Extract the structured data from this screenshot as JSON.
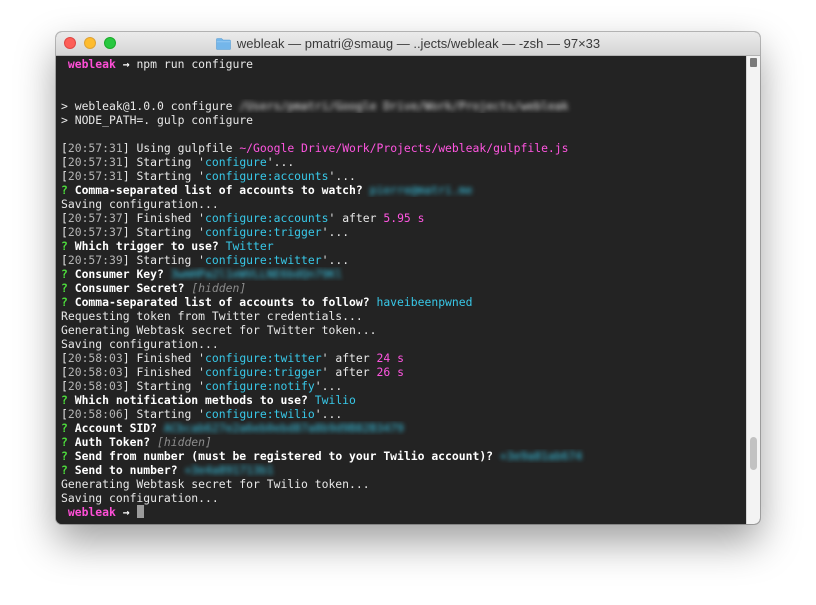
{
  "window": {
    "title": "webleak — pmatri@smaug — ..jects/webleak — -zsh — 97×33"
  },
  "terminal": {
    "lines": [
      [
        {
          "t": "webleak",
          "c": "prompt",
          "pre": " "
        },
        {
          "t": " → ",
          "c": "arrow"
        },
        {
          "t": "npm run configure",
          "c": "default"
        }
      ],
      [],
      [],
      [
        {
          "t": "> webleak@1.0.0 configure ",
          "c": "default"
        },
        {
          "t": "/Users/pmatri/Google Drive/Work/Projects/webleak",
          "c": "default",
          "blur": true
        }
      ],
      [
        {
          "t": "> NODE_PATH=. gulp configure",
          "c": "default"
        }
      ],
      [],
      [
        {
          "t": "[",
          "c": "default"
        },
        {
          "t": "20:57:31",
          "c": "ts"
        },
        {
          "t": "] Using gulpfile ",
          "c": "default"
        },
        {
          "t": "~/Google Drive/Work/Projects/webleak/gulpfile.js",
          "c": "magenta"
        }
      ],
      [
        {
          "t": "[",
          "c": "default"
        },
        {
          "t": "20:57:31",
          "c": "ts"
        },
        {
          "t": "] Starting '",
          "c": "default"
        },
        {
          "t": "configure",
          "c": "task"
        },
        {
          "t": "'...",
          "c": "default"
        }
      ],
      [
        {
          "t": "[",
          "c": "default"
        },
        {
          "t": "20:57:31",
          "c": "ts"
        },
        {
          "t": "] Starting '",
          "c": "default"
        },
        {
          "t": "configure:accounts",
          "c": "task"
        },
        {
          "t": "'...",
          "c": "default"
        }
      ],
      [
        {
          "t": "? ",
          "c": "green"
        },
        {
          "t": "Comma-separated list of accounts to watch? ",
          "c": "bold"
        },
        {
          "t": "pierre@matri.me",
          "c": "answer",
          "blur": true
        }
      ],
      [
        {
          "t": "Saving configuration...",
          "c": "default"
        }
      ],
      [
        {
          "t": "[",
          "c": "default"
        },
        {
          "t": "20:57:37",
          "c": "ts"
        },
        {
          "t": "] Finished '",
          "c": "default"
        },
        {
          "t": "configure:accounts",
          "c": "task"
        },
        {
          "t": "' after ",
          "c": "default"
        },
        {
          "t": "5.95 s",
          "c": "magenta"
        }
      ],
      [
        {
          "t": "[",
          "c": "default"
        },
        {
          "t": "20:57:37",
          "c": "ts"
        },
        {
          "t": "] Starting '",
          "c": "default"
        },
        {
          "t": "configure:trigger",
          "c": "task"
        },
        {
          "t": "'...",
          "c": "default"
        }
      ],
      [
        {
          "t": "? ",
          "c": "green"
        },
        {
          "t": "Which trigger to use? ",
          "c": "bold"
        },
        {
          "t": "Twitter",
          "c": "answer"
        }
      ],
      [
        {
          "t": "[",
          "c": "default"
        },
        {
          "t": "20:57:39",
          "c": "ts"
        },
        {
          "t": "] Starting '",
          "c": "default"
        },
        {
          "t": "configure:twitter",
          "c": "task"
        },
        {
          "t": "'...",
          "c": "default"
        }
      ],
      [
        {
          "t": "? ",
          "c": "green"
        },
        {
          "t": "Consumer Key? ",
          "c": "bold"
        },
        {
          "t": "3wmHPa2l1eWVLLNE6bdQn79Kl",
          "c": "answer",
          "blur": true
        }
      ],
      [
        {
          "t": "? ",
          "c": "green"
        },
        {
          "t": "Consumer Secret? ",
          "c": "bold"
        },
        {
          "t": "[hidden]",
          "c": "hidden"
        }
      ],
      [
        {
          "t": "? ",
          "c": "green"
        },
        {
          "t": "Comma-separated list of accounts to follow? ",
          "c": "bold"
        },
        {
          "t": "haveibeenpwned",
          "c": "answer"
        }
      ],
      [
        {
          "t": "Requesting token from Twitter credentials...",
          "c": "default"
        }
      ],
      [
        {
          "t": "Generating Webtask secret for Twitter token...",
          "c": "default"
        }
      ],
      [
        {
          "t": "Saving configuration...",
          "c": "default"
        }
      ],
      [
        {
          "t": "[",
          "c": "default"
        },
        {
          "t": "20:58:03",
          "c": "ts"
        },
        {
          "t": "] Finished '",
          "c": "default"
        },
        {
          "t": "configure:twitter",
          "c": "task"
        },
        {
          "t": "' after ",
          "c": "default"
        },
        {
          "t": "24 s",
          "c": "magenta"
        }
      ],
      [
        {
          "t": "[",
          "c": "default"
        },
        {
          "t": "20:58:03",
          "c": "ts"
        },
        {
          "t": "] Finished '",
          "c": "default"
        },
        {
          "t": "configure:trigger",
          "c": "task"
        },
        {
          "t": "' after ",
          "c": "default"
        },
        {
          "t": "26 s",
          "c": "magenta"
        }
      ],
      [
        {
          "t": "[",
          "c": "default"
        },
        {
          "t": "20:58:03",
          "c": "ts"
        },
        {
          "t": "] Starting '",
          "c": "default"
        },
        {
          "t": "configure:notify",
          "c": "task"
        },
        {
          "t": "'...",
          "c": "default"
        }
      ],
      [
        {
          "t": "? ",
          "c": "green"
        },
        {
          "t": "Which notification methods to use? ",
          "c": "bold"
        },
        {
          "t": "Twilio",
          "c": "answer"
        }
      ],
      [
        {
          "t": "[",
          "c": "default"
        },
        {
          "t": "20:58:06",
          "c": "ts"
        },
        {
          "t": "] Starting '",
          "c": "default"
        },
        {
          "t": "configure:twilio",
          "c": "task"
        },
        {
          "t": "'...",
          "c": "default"
        }
      ],
      [
        {
          "t": "? ",
          "c": "green"
        },
        {
          "t": "Account SID? ",
          "c": "bold"
        },
        {
          "t": "ACbcab627e2a6eb0ebd87a8b9d9B82B3479",
          "c": "answer",
          "blur": true
        }
      ],
      [
        {
          "t": "? ",
          "c": "green"
        },
        {
          "t": "Auth Token? ",
          "c": "bold"
        },
        {
          "t": "[hidden]",
          "c": "hidden"
        }
      ],
      [
        {
          "t": "? ",
          "c": "green"
        },
        {
          "t": "Send from number (must be registered to your Twilio account)? ",
          "c": "bold"
        },
        {
          "t": "+3e9a81ab674",
          "c": "answer",
          "blur": true
        }
      ],
      [
        {
          "t": "? ",
          "c": "green"
        },
        {
          "t": "Send to number? ",
          "c": "bold"
        },
        {
          "t": "+3e4a891713b1",
          "c": "answer",
          "blur": true
        }
      ],
      [
        {
          "t": "Generating Webtask secret for Twilio token...",
          "c": "default"
        }
      ],
      [
        {
          "t": "Saving configuration...",
          "c": "default"
        }
      ],
      [
        {
          "t": "webleak",
          "c": "prompt",
          "pre": " "
        },
        {
          "t": " → ",
          "c": "arrow"
        },
        {
          "cursor": true
        }
      ]
    ]
  },
  "scrollbar": {
    "position": 0.88,
    "visible_fraction": 0.07
  },
  "colors": {
    "background": "#232323",
    "prompt": "#ff4fd7",
    "task": "#38c8e8",
    "number": "#ff55e0",
    "question_mark": "#4ddc3c"
  }
}
